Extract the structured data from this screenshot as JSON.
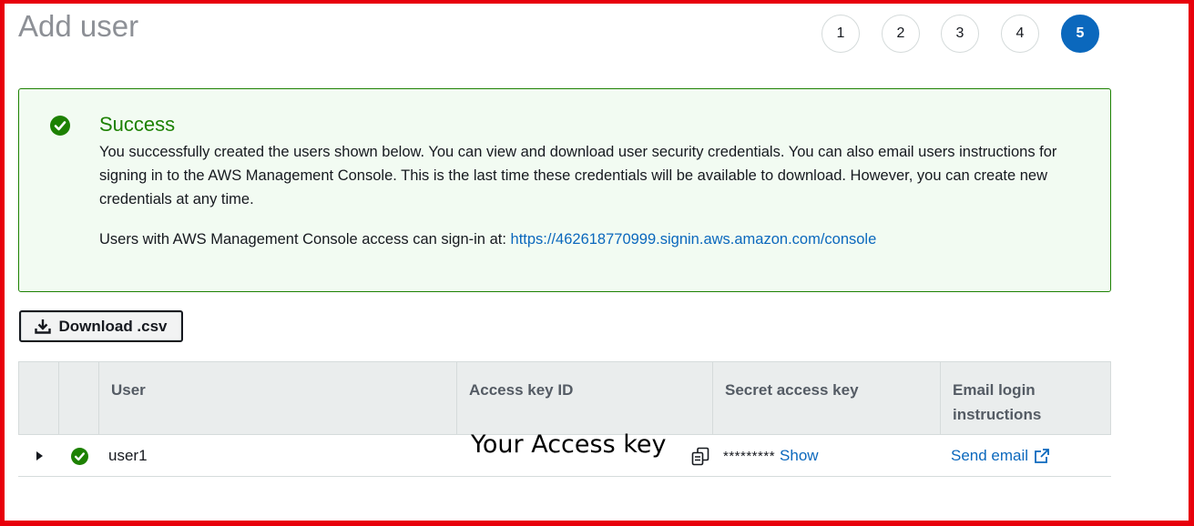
{
  "page": {
    "title": "Add user"
  },
  "steps": [
    {
      "label": "1",
      "active": false
    },
    {
      "label": "2",
      "active": false
    },
    {
      "label": "3",
      "active": false
    },
    {
      "label": "4",
      "active": false
    },
    {
      "label": "5",
      "active": true
    }
  ],
  "alert": {
    "title": "Success",
    "body": "You successfully created the users shown below. You can view and download user security credentials. You can also email users instructions for signing in to the AWS Management Console. This is the last time these credentials will be available to download. However, you can create new credentials at any time.",
    "signin_prefix": "Users with AWS Management Console access can sign-in at: ",
    "signin_url": "https://462618770999.signin.aws.amazon.com/console"
  },
  "download": {
    "label": "Download .csv"
  },
  "table": {
    "columns": {
      "user": "User",
      "access_key_id": "Access key ID",
      "secret_access_key": "Secret access key",
      "email_line1": "Email login",
      "email_line2": "instructions"
    },
    "rows": [
      {
        "user": "user1",
        "access_key_note": "Your Access key",
        "secret_masked": "*********",
        "show_label": "Show",
        "send_email_label": "Send email"
      }
    ]
  },
  "colors": {
    "success": "#1d8102",
    "link": "#0b68bd",
    "frame": "#e8000b"
  },
  "icons": [
    "check-circle-icon",
    "download-icon",
    "caret-right-icon",
    "copy-icon",
    "external-link-icon"
  ]
}
